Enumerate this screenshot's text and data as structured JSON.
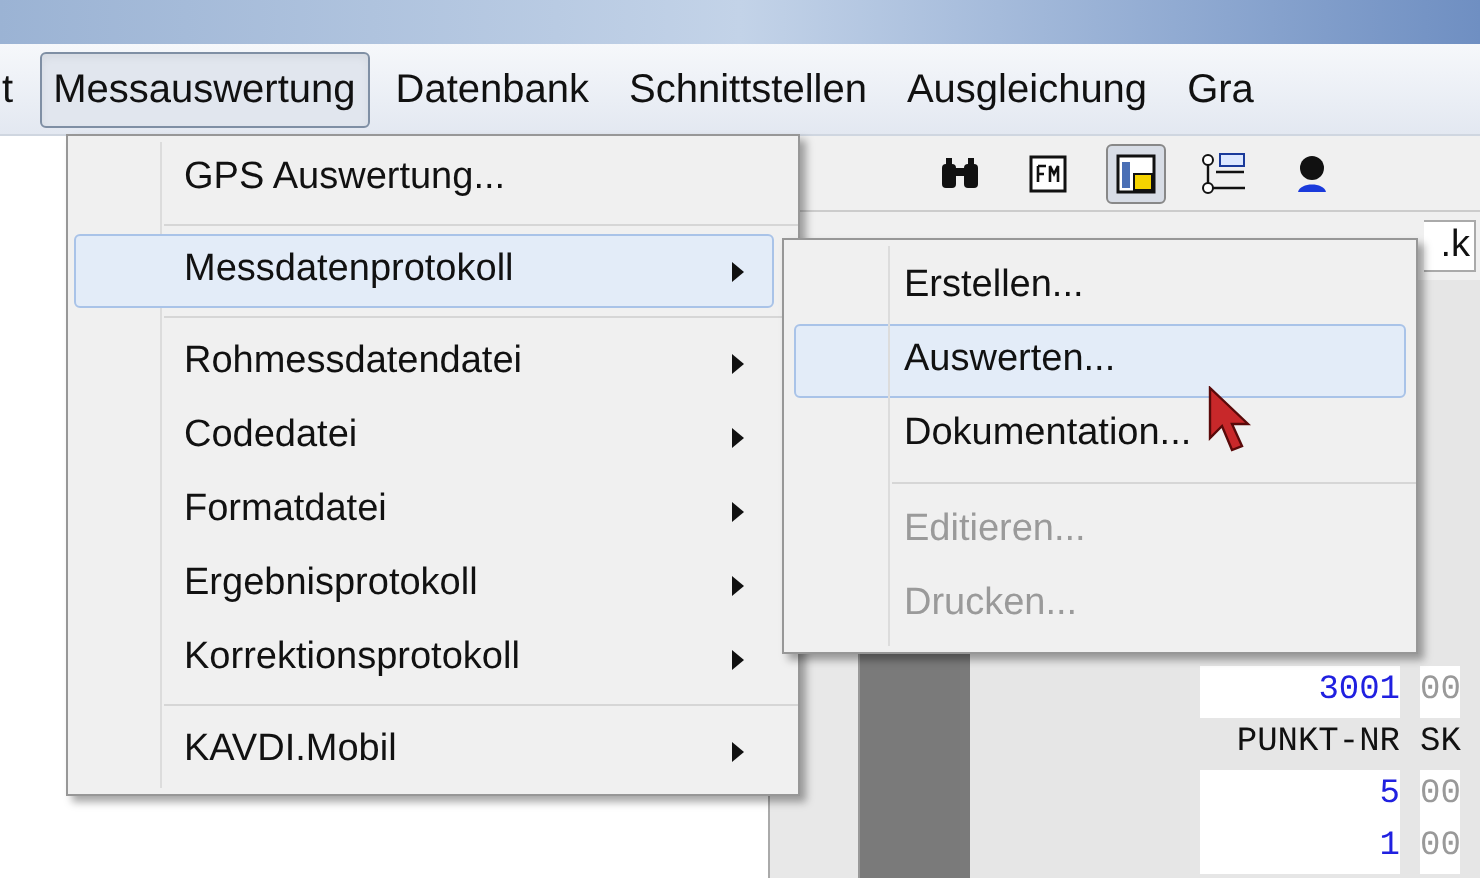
{
  "menubar": [
    {
      "label": "t",
      "selected": false
    },
    {
      "label": "Messauswertung",
      "selected": true
    },
    {
      "label": "Datenbank",
      "selected": false
    },
    {
      "label": "Schnittstellen",
      "selected": false
    },
    {
      "label": "Ausgleichung",
      "selected": false
    },
    {
      "label": "Gra",
      "selected": false
    }
  ],
  "toolbar_buttons": [
    {
      "kind": "binoculars",
      "pressed": false
    },
    {
      "kind": "fm",
      "pressed": false
    },
    {
      "kind": "panel",
      "pressed": true
    },
    {
      "kind": "tree",
      "pressed": false
    },
    {
      "kind": "person",
      "pressed": false
    }
  ],
  "field": {
    "value": ".k"
  },
  "listing": [
    {
      "kind": "data",
      "number": "3001",
      "code": "00"
    },
    {
      "kind": "header",
      "number": "PUNKT-NR",
      "code": "SK"
    },
    {
      "kind": "data",
      "number": "5",
      "code": "00"
    },
    {
      "kind": "data",
      "number": "1",
      "code": "00"
    }
  ],
  "menu": [
    {
      "kind": "item",
      "label": "GPS Auswertung...",
      "submenu": false,
      "selected": false
    },
    {
      "kind": "separator"
    },
    {
      "kind": "item",
      "label": "Messdatenprotokoll",
      "submenu": true,
      "selected": true
    },
    {
      "kind": "separator"
    },
    {
      "kind": "item",
      "label": "Rohmessdatendatei",
      "submenu": true,
      "selected": false
    },
    {
      "kind": "item",
      "label": "Codedatei",
      "submenu": true,
      "selected": false
    },
    {
      "kind": "item",
      "label": "Formatdatei",
      "submenu": true,
      "selected": false
    },
    {
      "kind": "item",
      "label": "Ergebnisprotokoll",
      "submenu": true,
      "selected": false
    },
    {
      "kind": "item",
      "label": "Korrektionsprotokoll",
      "submenu": true,
      "selected": false
    },
    {
      "kind": "separator"
    },
    {
      "kind": "item",
      "label": "KAVDI.Mobil",
      "submenu": true,
      "selected": false
    }
  ],
  "submenu": [
    {
      "kind": "item",
      "label": "Erstellen...",
      "selected": false,
      "disabled": false
    },
    {
      "kind": "item",
      "label": "Auswerten...",
      "selected": true,
      "disabled": false
    },
    {
      "kind": "item",
      "label": "Dokumentation...",
      "selected": false,
      "disabled": false
    },
    {
      "kind": "separator"
    },
    {
      "kind": "item",
      "label": "Editieren...",
      "selected": false,
      "disabled": true
    },
    {
      "kind": "item",
      "label": "Drucken...",
      "selected": false,
      "disabled": true
    }
  ]
}
